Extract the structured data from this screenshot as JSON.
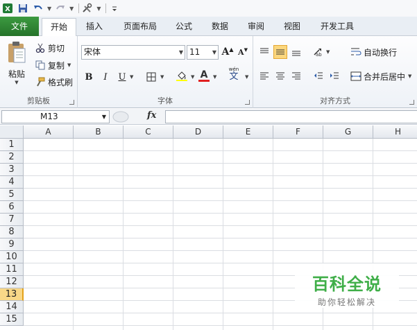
{
  "qat": {
    "icons": [
      "excel-logo-icon",
      "save-icon",
      "undo-icon",
      "redo-icon",
      "tools-icon",
      "customize-icon"
    ]
  },
  "tabs": [
    {
      "label": "文件"
    },
    {
      "label": "开始"
    },
    {
      "label": "插入"
    },
    {
      "label": "页面布局"
    },
    {
      "label": "公式"
    },
    {
      "label": "数据"
    },
    {
      "label": "审阅"
    },
    {
      "label": "视图"
    },
    {
      "label": "开发工具"
    }
  ],
  "clipboard": {
    "paste": "粘贴",
    "cut": "剪切",
    "copy": "复制",
    "format_painter": "格式刷",
    "group_label": "剪贴板"
  },
  "font": {
    "name": "宋体",
    "size": "11",
    "grow": "A",
    "shrink": "A",
    "bold": "B",
    "italic": "I",
    "underline": "U",
    "font_color": "A",
    "phonetic": "wén",
    "phonetic_char": "文",
    "group_label": "字体"
  },
  "alignment": {
    "wrap_text": "自动换行",
    "merge_center": "合并后居中",
    "group_label": "对齐方式"
  },
  "formula_bar": {
    "name_box": "M13",
    "fx": "fx",
    "value": ""
  },
  "sheet": {
    "columns": [
      "A",
      "B",
      "C",
      "D",
      "E",
      "F",
      "G",
      "H"
    ],
    "rows": [
      "1",
      "2",
      "3",
      "4",
      "5",
      "6",
      "7",
      "8",
      "9",
      "10",
      "11",
      "12",
      "13",
      "14",
      "15"
    ],
    "selected_row": "13"
  },
  "watermark": {
    "title": "百科全说",
    "subtitle": "助你轻松解决"
  },
  "colors": {
    "file_tab": "#2f8a34",
    "selected_row": "#f9d888",
    "fill_highlight": "#ffff00",
    "font_red": "#e02020",
    "watermark_green": "#3fae48"
  }
}
